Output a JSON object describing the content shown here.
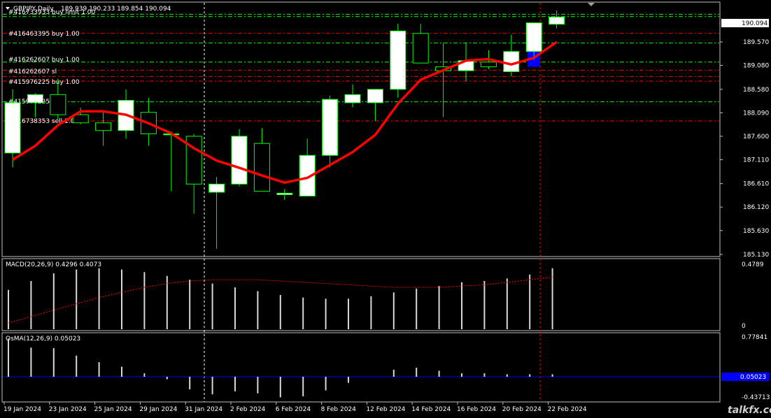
{
  "header": {
    "symbol_title": "GBPJPY,Daily",
    "ohlc": "189.939 190.233 189.854 190.094"
  },
  "price_axis": {
    "current_price": "190.094",
    "ticks": [
      "189.570",
      "189.080",
      "188.580",
      "188.090",
      "187.600",
      "187.110",
      "186.610",
      "186.120",
      "185.630",
      "185.130"
    ]
  },
  "order_labels": [
    "#416733933 buy limit 1.00",
    "#416463395 buy 1.00",
    "#416262607 buy 1.00",
    "#416262607 sl",
    "#415976225 buy 1.00",
    "#415976225 sl",
    "#416738353 sell 1.00"
  ],
  "macd": {
    "title": "MACD(20,26,9) 0.4296 0.4073",
    "axis_top": "0.4789",
    "axis_zero": "0"
  },
  "osma": {
    "title": "OsMA(12,26,9) 0.05023",
    "axis_top": "0.77841",
    "axis_current": "0.05023",
    "axis_bottom": "-0.43713"
  },
  "time_axis": [
    "19 Jan 2024",
    "23 Jan 2024",
    "25 Jan 2024",
    "29 Jan 2024",
    "31 Jan 2024",
    "2 Feb 2024",
    "6 Feb 2024",
    "8 Feb 2024",
    "12 Feb 2024",
    "14 Feb 2024",
    "16 Feb 2024",
    "20 Feb 2024",
    "22 Feb 2024"
  ],
  "watermark": "talkfx.com",
  "colors": {
    "bull_candle": "#ffffff",
    "bear_candle": "#000000",
    "wick": "#00ff00",
    "ma_line": "#ff0000",
    "grid": "#c0c0c0",
    "order_buy": "#00ff00",
    "order_sl": "#ff0000",
    "osma_zero": "#0000ff",
    "selection": "#0000ff"
  },
  "candles": [
    {
      "o": 187.25,
      "h": 188.58,
      "l": 186.95,
      "c": 188.3
    },
    {
      "o": 188.3,
      "h": 188.5,
      "l": 188.0,
      "c": 188.47
    },
    {
      "o": 188.47,
      "h": 188.8,
      "l": 187.95,
      "c": 188.05
    },
    {
      "o": 188.05,
      "h": 188.2,
      "l": 187.85,
      "c": 187.88
    },
    {
      "o": 187.88,
      "h": 188.1,
      "l": 187.4,
      "c": 187.72
    },
    {
      "o": 187.72,
      "h": 188.58,
      "l": 187.55,
      "c": 188.35
    },
    {
      "o": 188.1,
      "h": 188.4,
      "l": 187.4,
      "c": 187.65
    },
    {
      "o": 187.63,
      "h": 187.7,
      "l": 186.45,
      "c": 187.65
    },
    {
      "o": 187.6,
      "h": 187.65,
      "l": 185.98,
      "c": 186.6
    },
    {
      "o": 186.43,
      "h": 186.75,
      "l": 185.25,
      "c": 186.6
    },
    {
      "o": 186.6,
      "h": 187.75,
      "l": 186.55,
      "c": 187.6
    },
    {
      "o": 187.45,
      "h": 187.77,
      "l": 186.45,
      "c": 186.45
    },
    {
      "o": 186.38,
      "h": 186.5,
      "l": 186.27,
      "c": 186.41
    },
    {
      "o": 186.35,
      "h": 187.55,
      "l": 186.35,
      "c": 187.2
    },
    {
      "o": 187.2,
      "h": 188.45,
      "l": 186.95,
      "c": 188.37
    },
    {
      "o": 188.3,
      "h": 188.68,
      "l": 188.2,
      "c": 188.47
    },
    {
      "o": 188.3,
      "h": 188.58,
      "l": 187.92,
      "c": 188.58
    },
    {
      "o": 188.58,
      "h": 189.95,
      "l": 188.4,
      "c": 189.8
    },
    {
      "o": 189.75,
      "h": 189.95,
      "l": 189.15,
      "c": 189.13
    },
    {
      "o": 189.05,
      "h": 189.55,
      "l": 188.0,
      "c": 188.97
    },
    {
      "o": 188.97,
      "h": 189.55,
      "l": 188.75,
      "c": 189.18
    },
    {
      "o": 189.15,
      "h": 189.4,
      "l": 189.0,
      "c": 189.05
    },
    {
      "o": 188.95,
      "h": 189.72,
      "l": 188.85,
      "c": 189.37
    },
    {
      "o": 189.37,
      "h": 189.97,
      "l": 189.2,
      "c": 189.97
    },
    {
      "o": 189.94,
      "h": 190.23,
      "l": 189.85,
      "c": 190.09
    }
  ],
  "ma": [
    187.11,
    187.4,
    187.83,
    188.12,
    188.12,
    188.05,
    187.87,
    187.66,
    187.35,
    187.09,
    186.94,
    186.78,
    186.63,
    186.73,
    187.0,
    187.27,
    187.63,
    188.28,
    188.78,
    188.98,
    189.18,
    189.21,
    189.1,
    189.24,
    189.57
  ],
  "orders": [
    {
      "price": 190.15,
      "type": "buy"
    },
    {
      "price": 190.1,
      "type": "buy"
    },
    {
      "price": 189.75,
      "type": "sl"
    },
    {
      "price": 189.55,
      "type": "buy"
    },
    {
      "price": 189.15,
      "type": "buy"
    },
    {
      "price": 188.98,
      "type": "sl"
    },
    {
      "price": 188.85,
      "type": "sl"
    },
    {
      "price": 188.75,
      "type": "sl"
    },
    {
      "price": 188.32,
      "type": "buy"
    },
    {
      "price": 187.92,
      "type": "sl"
    }
  ],
  "macd_hist": [
    0.31,
    0.38,
    0.44,
    0.47,
    0.48,
    0.47,
    0.45,
    0.42,
    0.39,
    0.36,
    0.33,
    0.3,
    0.27,
    0.25,
    0.24,
    0.24,
    0.26,
    0.29,
    0.32,
    0.34,
    0.37,
    0.38,
    0.4,
    0.43,
    0.48
  ],
  "macd_signal": [
    0.05,
    0.1,
    0.15,
    0.2,
    0.25,
    0.29,
    0.33,
    0.36,
    0.38,
    0.39,
    0.39,
    0.39,
    0.38,
    0.37,
    0.36,
    0.35,
    0.34,
    0.33,
    0.33,
    0.33,
    0.34,
    0.35,
    0.37,
    0.39,
    0.41
  ],
  "osma_hist": [
    0.76,
    0.58,
    0.57,
    0.42,
    0.29,
    0.2,
    0.07,
    -0.05,
    -0.25,
    -0.35,
    -0.29,
    -0.33,
    -0.41,
    -0.39,
    -0.27,
    -0.12,
    0.0,
    0.14,
    0.18,
    0.12,
    0.07,
    0.07,
    0.05,
    0.05,
    0.05
  ]
}
